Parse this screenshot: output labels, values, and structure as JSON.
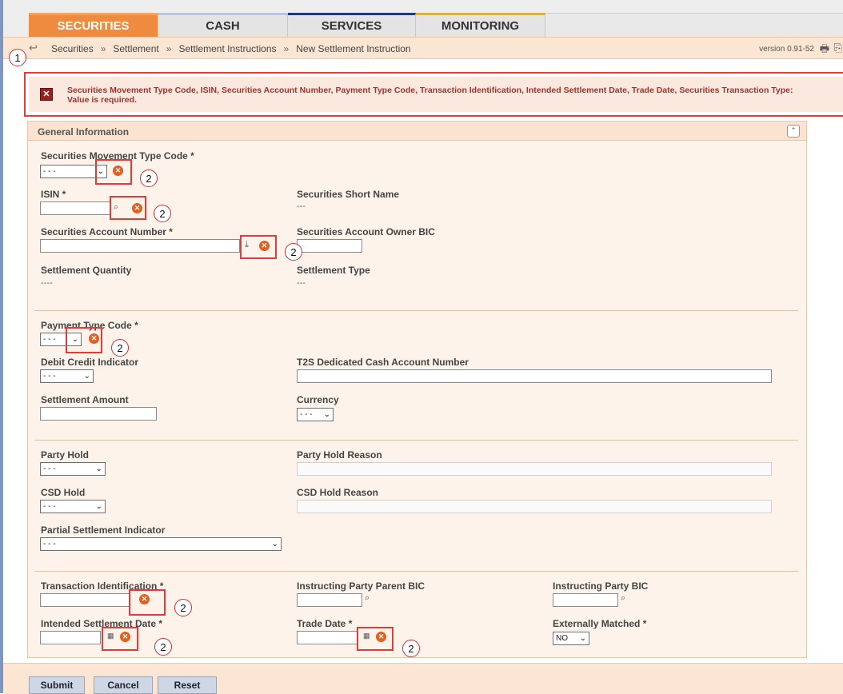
{
  "tabs": [
    {
      "label": "SECURITIES"
    },
    {
      "label": "CASH"
    },
    {
      "label": "SERVICES"
    },
    {
      "label": "MONITORING"
    }
  ],
  "breadcrumb": [
    "Securities",
    "Settlement",
    "Settlement Instructions",
    "New Settlement Instruction"
  ],
  "breadcrumb_separator": "»",
  "version": "version 0.91-52",
  "error": {
    "message": "Securities Movement Type Code, ISIN, Securities Account Number, Payment Type Code, Transaction Identification, Intended Settlement Date, Trade Date, Securities Transaction Type: Value is required."
  },
  "markers": {
    "one": "1",
    "two": "2"
  },
  "panel": {
    "title": "General Information"
  },
  "fields": {
    "securities_movement_type_code": {
      "label": "Securities Movement Type Code *",
      "value": "- - -"
    },
    "isin": {
      "label": "ISIN *",
      "value": ""
    },
    "securities_short_name": {
      "label": "Securities Short Name",
      "value": "---"
    },
    "securities_account_number": {
      "label": "Securities Account Number *",
      "value": ""
    },
    "securities_account_owner_bic": {
      "label": "Securities Account Owner BIC",
      "value": ""
    },
    "settlement_quantity": {
      "label": "Settlement Quantity",
      "value": "----"
    },
    "settlement_type": {
      "label": "Settlement Type",
      "value": "---"
    },
    "payment_type_code": {
      "label": "Payment Type Code *",
      "value": "- - -"
    },
    "debit_credit_indicator": {
      "label": "Debit Credit Indicator",
      "value": "- - -"
    },
    "t2s_dedicated_cash_account_number": {
      "label": "T2S Dedicated Cash Account Number",
      "value": ""
    },
    "settlement_amount": {
      "label": "Settlement Amount",
      "value": ""
    },
    "currency": {
      "label": "Currency",
      "value": "- - -"
    },
    "party_hold": {
      "label": "Party Hold",
      "value": "- - -"
    },
    "party_hold_reason": {
      "label": "Party Hold Reason",
      "value": ""
    },
    "csd_hold": {
      "label": "CSD Hold",
      "value": "- - -"
    },
    "csd_hold_reason": {
      "label": "CSD Hold Reason",
      "value": ""
    },
    "partial_settlement_indicator": {
      "label": "Partial Settlement Indicator",
      "value": "- - -"
    },
    "transaction_identification": {
      "label": "Transaction Identification *",
      "value": ""
    },
    "instructing_party_parent_bic": {
      "label": "Instructing Party Parent BIC",
      "value": ""
    },
    "instructing_party_bic": {
      "label": "Instructing Party BIC",
      "value": ""
    },
    "intended_settlement_date": {
      "label": "Intended Settlement Date *",
      "value": ""
    },
    "trade_date": {
      "label": "Trade Date *",
      "value": ""
    },
    "externally_matched": {
      "label": "Externally Matched *",
      "value": "NO"
    }
  },
  "buttons": {
    "submit": "Submit",
    "cancel": "Cancel",
    "reset": "Reset"
  },
  "icons": {
    "clear": "clear-icon",
    "search": "search-icon",
    "calendar": "calendar-icon",
    "download": "download-icon"
  },
  "colors": {
    "active_tab": "#ef8b3e",
    "error_text": "#a4322a",
    "annotation": "#e33a3a"
  }
}
